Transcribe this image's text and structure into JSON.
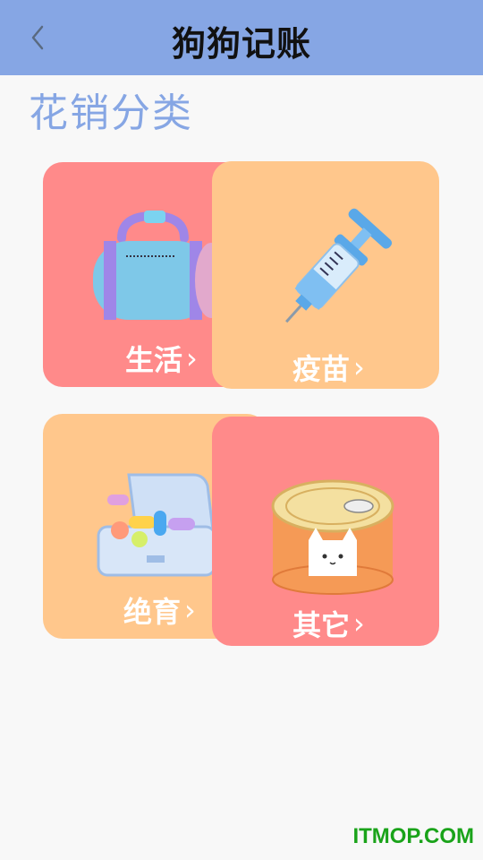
{
  "header": {
    "title": "狗狗记账",
    "back_icon": "chevron-left-icon"
  },
  "section": {
    "title": "花销分类"
  },
  "categories": [
    {
      "label": "生活",
      "icon": "bag-icon",
      "color": "#ff8a8a"
    },
    {
      "label": "疫苗",
      "icon": "syringe-icon",
      "color": "#ffc78c"
    },
    {
      "label": "绝育",
      "icon": "medicine-box-icon",
      "color": "#ffc78c"
    },
    {
      "label": "其它",
      "icon": "cat-can-icon",
      "color": "#ff8a8a"
    }
  ],
  "chevron": "›",
  "watermark": "ITMOP.COM",
  "colors": {
    "header": "#86a6e4",
    "pink": "#ff8a8a",
    "peach": "#ffc78c"
  }
}
